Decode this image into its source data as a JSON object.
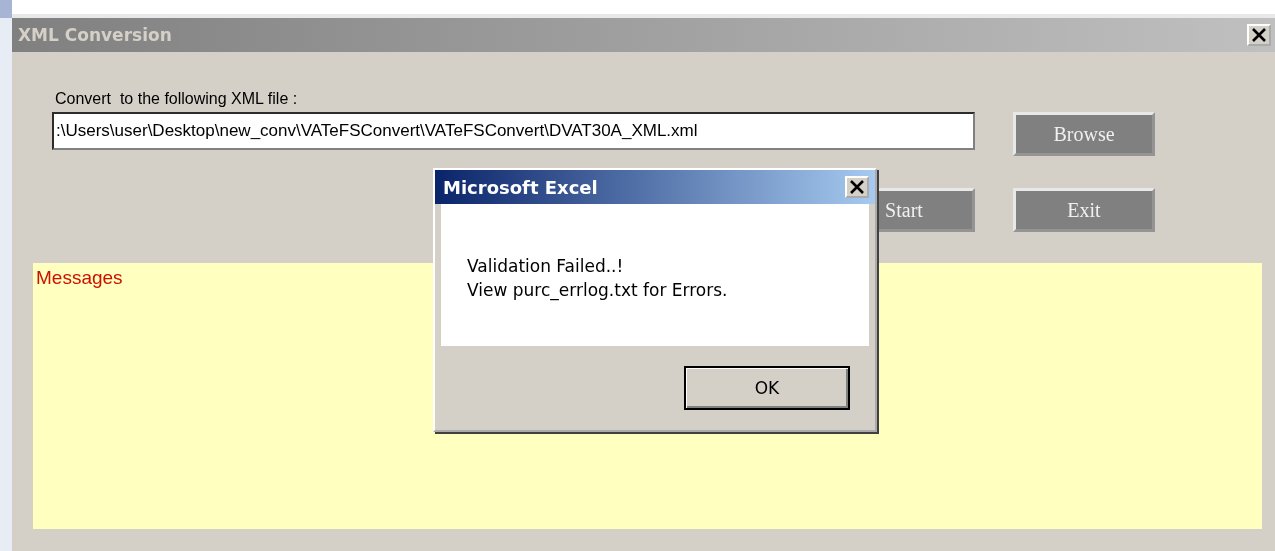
{
  "window": {
    "title": "XML Conversion"
  },
  "form": {
    "label": "Convert  to the following XML file :",
    "path_value": ":\\Users\\user\\Desktop\\new_conv\\VATeFSConvert\\VATeFSConvert\\DVAT30A_XML.xml"
  },
  "buttons": [
    {
      "label": "Browse",
      "kind": "browse"
    },
    {
      "label": "Start",
      "kind": "action"
    },
    {
      "label": "Exit",
      "kind": "action"
    }
  ],
  "messages": {
    "title": "Messages"
  },
  "dialog": {
    "title": "Microsoft Excel",
    "lines": [
      "Validation Failed..!",
      "View purc_errlog.txt for Errors."
    ],
    "button": "OK"
  }
}
